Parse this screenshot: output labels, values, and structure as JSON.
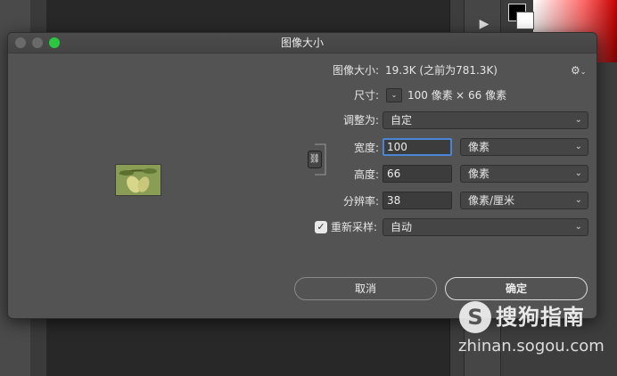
{
  "dialog": {
    "title": "图像大小",
    "image_size_label": "图像大小:",
    "image_size_value": "19.3K (之前为781.3K)",
    "dimensions_label": "尺寸:",
    "dimensions_width": "100 像素",
    "dimensions_times": "×",
    "dimensions_height": "66 像素",
    "fit_to_label": "调整为:",
    "fit_to_value": "自定",
    "width_label": "宽度:",
    "width_value": "100",
    "width_unit": "像素",
    "height_label": "高度:",
    "height_value": "66",
    "height_unit": "像素",
    "resolution_label": "分辨率:",
    "resolution_value": "38",
    "resolution_unit": "像素/厘米",
    "resample_label": "重新采样:",
    "resample_checked": true,
    "resample_value": "自动",
    "cancel_label": "取消",
    "ok_label": "确定"
  },
  "icons": {
    "gear": "⚙",
    "chevron": "⌄",
    "chain": "⛓",
    "check": "✓",
    "play": "▶"
  },
  "watermark": {
    "logo_letter": "S",
    "brand": "搜狗指南",
    "url": "zhinan.sogou.com"
  },
  "colors": {
    "dialog_bg": "#535353",
    "focus_blue": "#4a86d6",
    "maximize_green": "#2ac840"
  }
}
